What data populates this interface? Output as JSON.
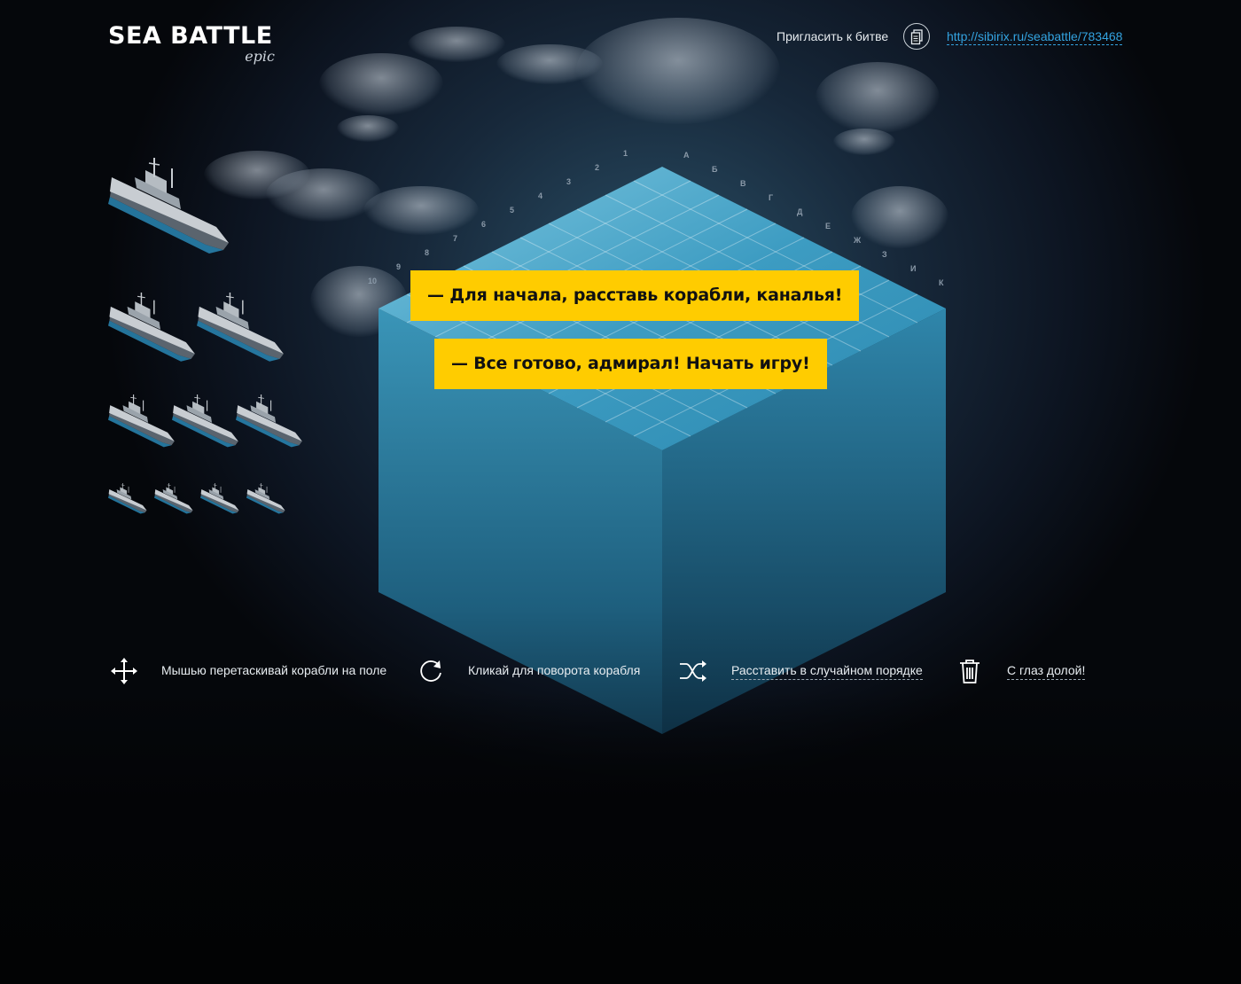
{
  "header": {
    "logo_title": "SEA BATTLE",
    "logo_subtitle": "epic",
    "invite_label": "Пригласить к битве",
    "invite_link": "http://sibirix.ru/seabattle/783468"
  },
  "board": {
    "row_labels": [
      "1",
      "2",
      "3",
      "4",
      "5",
      "6",
      "7",
      "8",
      "9",
      "10"
    ],
    "col_labels": [
      "А",
      "Б",
      "В",
      "Г",
      "Д",
      "Е",
      "Ж",
      "З",
      "И",
      "К"
    ]
  },
  "fleet": {
    "rows": [
      {
        "ship_size": 4,
        "count": 1
      },
      {
        "ship_size": 3,
        "count": 2
      },
      {
        "ship_size": 2,
        "count": 3
      },
      {
        "ship_size": 1,
        "count": 4
      }
    ]
  },
  "banners": {
    "place_ships": "— Для начала, расставь корабли, каналья!",
    "start_game": "— Все готово, адмирал! Начать игру!"
  },
  "controls": {
    "drag_hint": "Мышью перетаскивай корабли на поле",
    "rotate_hint": "Кликай для поворота корабля",
    "random_place": "Расставить в случайном порядке",
    "clear": "С глаз долой!"
  },
  "colors": {
    "accent_yellow": "#ffcc00",
    "link_blue": "#33a3e0",
    "water": "#3a95b8"
  }
}
